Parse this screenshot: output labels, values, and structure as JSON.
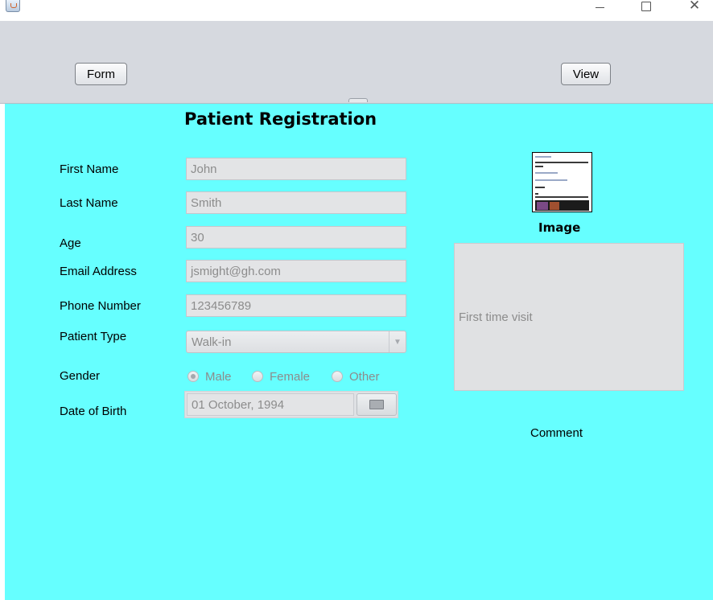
{
  "window": {
    "app_icon": "java-cup-icon",
    "controls": {
      "minimize": "minimize-icon",
      "maximize": "maximize-icon",
      "close": "close-icon"
    }
  },
  "toolbar": {
    "form_label": "Form",
    "view_label": "View"
  },
  "form": {
    "title": "Patient Registration",
    "first_name_label": "First Name",
    "first_name_value": "John",
    "last_name_label": "Last Name",
    "last_name_value": "Smith",
    "age_label": "Age",
    "age_value": "30",
    "email_label": "Email Address",
    "email_value": "jsmight@gh.com",
    "phone_label": "Phone Number",
    "phone_value": "123456789",
    "patient_type_label": "Patient Type",
    "patient_type_value": "Walk-in",
    "gender_label": "Gender",
    "gender_options": [
      "Male",
      "Female",
      "Other"
    ],
    "gender_selected": "Male",
    "dob_label": "Date of Birth",
    "dob_value": "01 October, 1994"
  },
  "side": {
    "image_label": "Image",
    "comment_value": "First time visit",
    "comment_label": "Comment"
  },
  "colors": {
    "panel_bg": "#66ffff",
    "toolbar_bg": "#d6d9df",
    "disabled_text": "#8c8c8c"
  }
}
